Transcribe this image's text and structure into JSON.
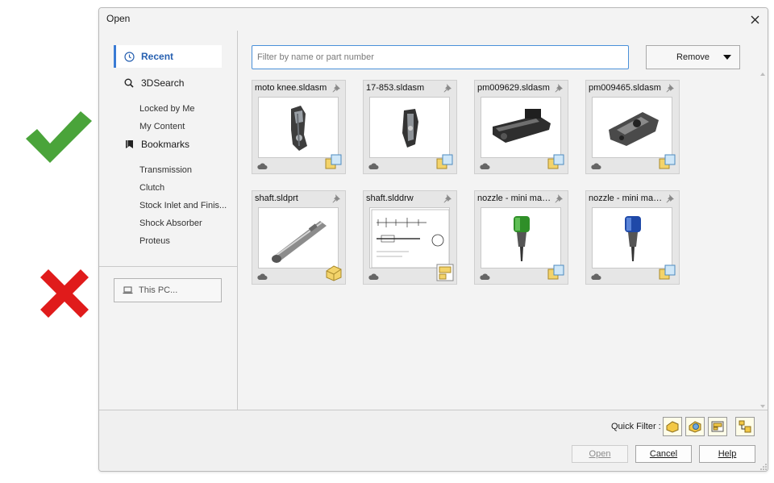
{
  "dialog": {
    "title": "Open",
    "close_icon": "close-icon"
  },
  "annotations": {
    "check_color": "#4aa43a",
    "cross_color": "#e01b1b"
  },
  "sidebar": {
    "recent_label": "Recent",
    "search_label": "3DSearch",
    "search_items": [
      "Locked by Me",
      "My Content"
    ],
    "bookmarks_label": "Bookmarks",
    "bookmark_items": [
      "Transmission",
      "Clutch",
      "Stock Inlet and Finis...",
      "Shock Absorber",
      "Proteus"
    ],
    "this_pc_label": "This PC..."
  },
  "toolbar": {
    "filter_placeholder": "Filter by name or part number",
    "filter_value": "",
    "remove_label": "Remove"
  },
  "files": [
    {
      "name": "moto knee.sldasm",
      "type": "assembly",
      "thumb": "moto-knee-thumbnail"
    },
    {
      "name": "17-853.sldasm",
      "type": "assembly",
      "thumb": "17-853-thumbnail"
    },
    {
      "name": "pm009629.sldasm",
      "type": "assembly",
      "thumb": "pm009629-thumbnail"
    },
    {
      "name": "pm009465.sldasm",
      "type": "assembly",
      "thumb": "pm009465-thumbnail"
    },
    {
      "name": "shaft.sldprt",
      "type": "part",
      "thumb": "shaft-part-thumbnail"
    },
    {
      "name": "shaft.slddrw",
      "type": "drawing",
      "thumb": "shaft-drawing-thumbnail"
    },
    {
      "name": "nozzle - mini maxj...",
      "type": "part",
      "thumb": "nozzle-green-thumbnail"
    },
    {
      "name": "nozzle - mini maxj...",
      "type": "part",
      "thumb": "nozzle-blue-thumbnail"
    }
  ],
  "footer": {
    "quick_filter_label": "Quick Filter :",
    "quick_filters": [
      "filter-parts-icon",
      "filter-assemblies-icon",
      "filter-drawings-icon",
      "filter-top-assemblies-icon"
    ],
    "open_label": "Open",
    "cancel_label": "Cancel",
    "help_label": "Help"
  }
}
